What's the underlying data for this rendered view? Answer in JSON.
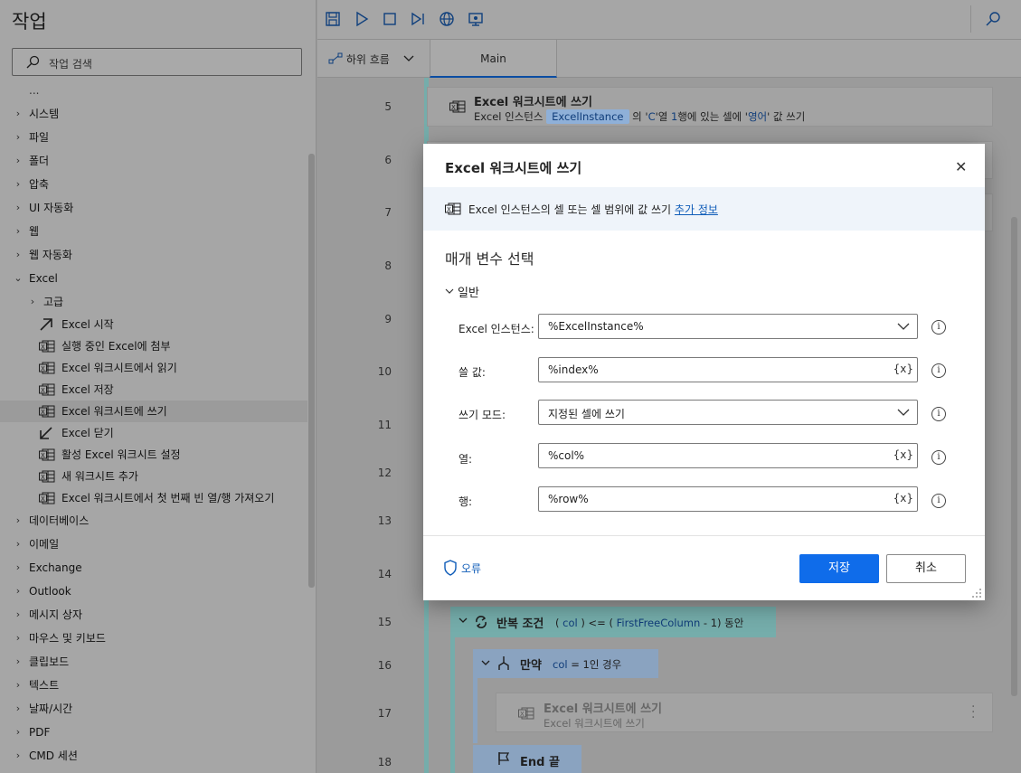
{
  "left": {
    "title": "작업",
    "search_placeholder": "작업 검색",
    "partial_item": "...",
    "categories_top": [
      "시스템",
      "파일",
      "폴더",
      "압축",
      "UI 자동화",
      "웹",
      "웹 자동화"
    ],
    "excel_category": "Excel",
    "excel_sub": {
      "advanced": "고급",
      "items": [
        "Excel 시작",
        "실행 중인 Excel에 첨부",
        "Excel 워크시트에서 읽기",
        "Excel 저장",
        "Excel 워크시트에 쓰기",
        "Excel 닫기",
        "활성 Excel 워크시트 설정",
        "새 워크시트 추가",
        "Excel 워크시트에서 첫 번째 빈 열/행 가져오기"
      ]
    },
    "categories_bottom": [
      "데이터베이스",
      "이메일",
      "Exchange",
      "Outlook",
      "메시지 상자",
      "마우스 및 키보드",
      "클립보드",
      "텍스트",
      "날짜/시간",
      "PDF",
      "CMD 세션"
    ]
  },
  "tabs": {
    "subflows": "하위 흐름",
    "main": "Main"
  },
  "canvas": {
    "line_numbers": [
      "5",
      "6",
      "7",
      "8",
      "9",
      "10",
      "11",
      "12",
      "13",
      "14",
      "15",
      "16",
      "17",
      "18"
    ],
    "step5": {
      "title": "Excel 워크시트에 쓰기",
      "desc_a": "Excel 인스턴스",
      "chip": "ExcelInstance",
      "desc_b": "의 '",
      "col_letter": "C",
      "desc_c": "'열",
      "row_num": "1",
      "desc_d": "행에 있는 셀에 '",
      "value": "영어",
      "desc_e": "' 값 쓰기"
    },
    "loop": {
      "keyword": "반복 조건",
      "open": "(",
      "var": "col",
      "op": ") <= (",
      "var2": "FirstFreeColumn",
      "tail": "- 1) 동안"
    },
    "if": {
      "keyword": "만약",
      "var": "col",
      "tail": "= 1인 경우"
    },
    "step17": {
      "title": "Excel 워크시트에 쓰기",
      "desc": "Excel 워크시트에 쓰기"
    },
    "end": {
      "label": "End 끝"
    }
  },
  "dialog": {
    "title": "Excel 워크시트에 쓰기",
    "info_text": "Excel 인스턴스의 셀 또는 셀 범위에 값 쓰기",
    "info_link": "추가 정보",
    "section": "매개 변수 선택",
    "group": "일반",
    "params": [
      {
        "label": "Excel 인스턴스:",
        "value": "%ExcelInstance%"
      },
      {
        "label": "쓸 값:",
        "value": "%index%"
      },
      {
        "label": "쓰기 모드:",
        "value": "지정된 셀에 쓰기"
      },
      {
        "label": "열:",
        "value": "%col%"
      },
      {
        "label": "행:",
        "value": "%row%"
      }
    ],
    "var_button": "{x}",
    "info_icon": "i",
    "error_label": "오류",
    "save": "저장",
    "cancel": "취소"
  }
}
